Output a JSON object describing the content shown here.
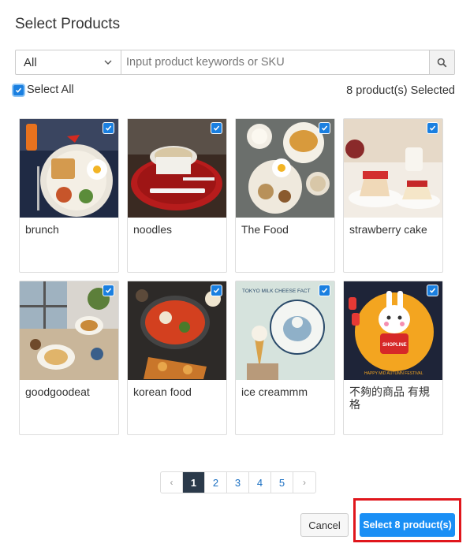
{
  "dialog": {
    "title": "Select Products"
  },
  "filter": {
    "category_value": "All",
    "keyword_placeholder": "Input product keywords or SKU"
  },
  "selection": {
    "select_all_label": "Select All",
    "select_all_checked": true,
    "count_text": "8 product(s) Selected"
  },
  "products": [
    {
      "name": "brunch",
      "checked": true
    },
    {
      "name": "noodles",
      "checked": true
    },
    {
      "name": "The Food",
      "checked": true
    },
    {
      "name": "strawberry cake",
      "checked": true
    },
    {
      "name": "goodgoodeat",
      "checked": true
    },
    {
      "name": "korean food",
      "checked": true
    },
    {
      "name": "ice creammm",
      "checked": true
    },
    {
      "name": "不夠的商品 有規格",
      "checked": true
    }
  ],
  "thumb_text": {
    "ice_cream_sign": "TOKYO MILK CHEESE FACT",
    "festival_brand": "SHOPLINE",
    "festival_caption": "HAPPY MID AUTUMN FESTIVAL"
  },
  "pagination": {
    "prev": "‹",
    "next": "›",
    "pages": [
      "1",
      "2",
      "3",
      "4",
      "5"
    ],
    "current": "1"
  },
  "footer": {
    "cancel_label": "Cancel",
    "submit_label": "Select 8 product(s)"
  },
  "colors": {
    "accent": "#1a8ff5",
    "checkbox": "#1a7fe0",
    "highlight": "#e0161c",
    "active_page": "#2b3a4a"
  }
}
